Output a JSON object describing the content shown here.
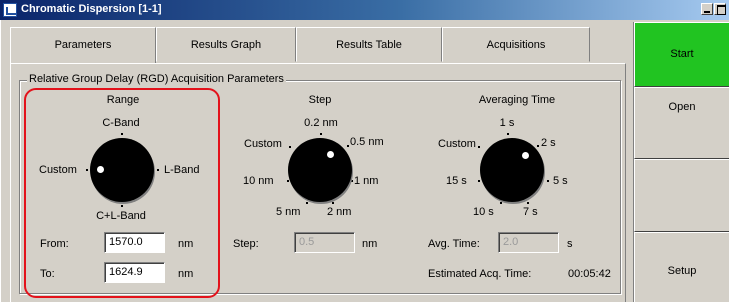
{
  "window": {
    "title": "Chromatic Dispersion [1-1]"
  },
  "tabs": [
    {
      "label": "Parameters"
    },
    {
      "label": "Results Graph"
    },
    {
      "label": "Results Table"
    },
    {
      "label": "Acquisitions"
    }
  ],
  "group": {
    "title": "Relative Group Delay (RGD) Acquisition Parameters"
  },
  "range": {
    "title": "Range",
    "options": {
      "top": "C-Band",
      "right": "L-Band",
      "bottom": "C+L-Band",
      "left": "Custom"
    },
    "from_label": "From:",
    "from_value": "1570.0",
    "to_label": "To:",
    "to_value": "1624.9",
    "unit": "nm"
  },
  "step": {
    "title": "Step",
    "options": [
      "0.2 nm",
      "0.5 nm",
      "1 nm",
      "2 nm",
      "5 nm",
      "10 nm",
      "Custom"
    ],
    "label": "Step:",
    "value": "0.5",
    "unit": "nm"
  },
  "avg": {
    "title": "Averaging Time",
    "options": [
      "1 s",
      "2 s",
      "5 s",
      "7 s",
      "10 s",
      "15 s",
      "Custom"
    ],
    "label": "Avg. Time:",
    "value": "2.0",
    "unit": "s"
  },
  "estimate": {
    "label": "Estimated Acq. Time:",
    "value": "00:05:42"
  },
  "buttons": {
    "start": "Start",
    "open": "Open",
    "setup": "Setup"
  },
  "colors": {
    "start_green": "#21c421",
    "highlight_red": "#e3121b",
    "titlebar_blue": "#0a246a"
  }
}
